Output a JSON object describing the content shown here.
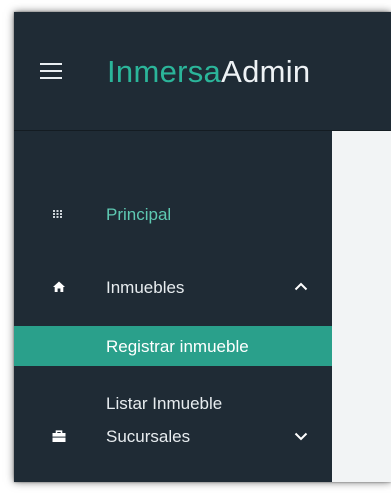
{
  "header": {
    "brand_part1": "Inmersa",
    "brand_part2": "Admin",
    "menu_icon": "hamburger-icon"
  },
  "sidebar": {
    "items": [
      {
        "label": "Principal",
        "icon": "grid-icon"
      },
      {
        "label": "Inmuebles",
        "icon": "home-icon",
        "chevron": "chevron-up-icon"
      },
      {
        "label": "Registrar inmueble",
        "active": true
      },
      {
        "label": "Listar Inmueble"
      },
      {
        "label": "Sucursales",
        "icon": "briefcase-icon",
        "chevron": "chevron-down-icon"
      }
    ]
  },
  "colors": {
    "sidebar_bg": "#1f2b35",
    "accent": "#2bb59a",
    "active_bg": "#2aa08b",
    "content_bg": "#f2f4f5"
  }
}
